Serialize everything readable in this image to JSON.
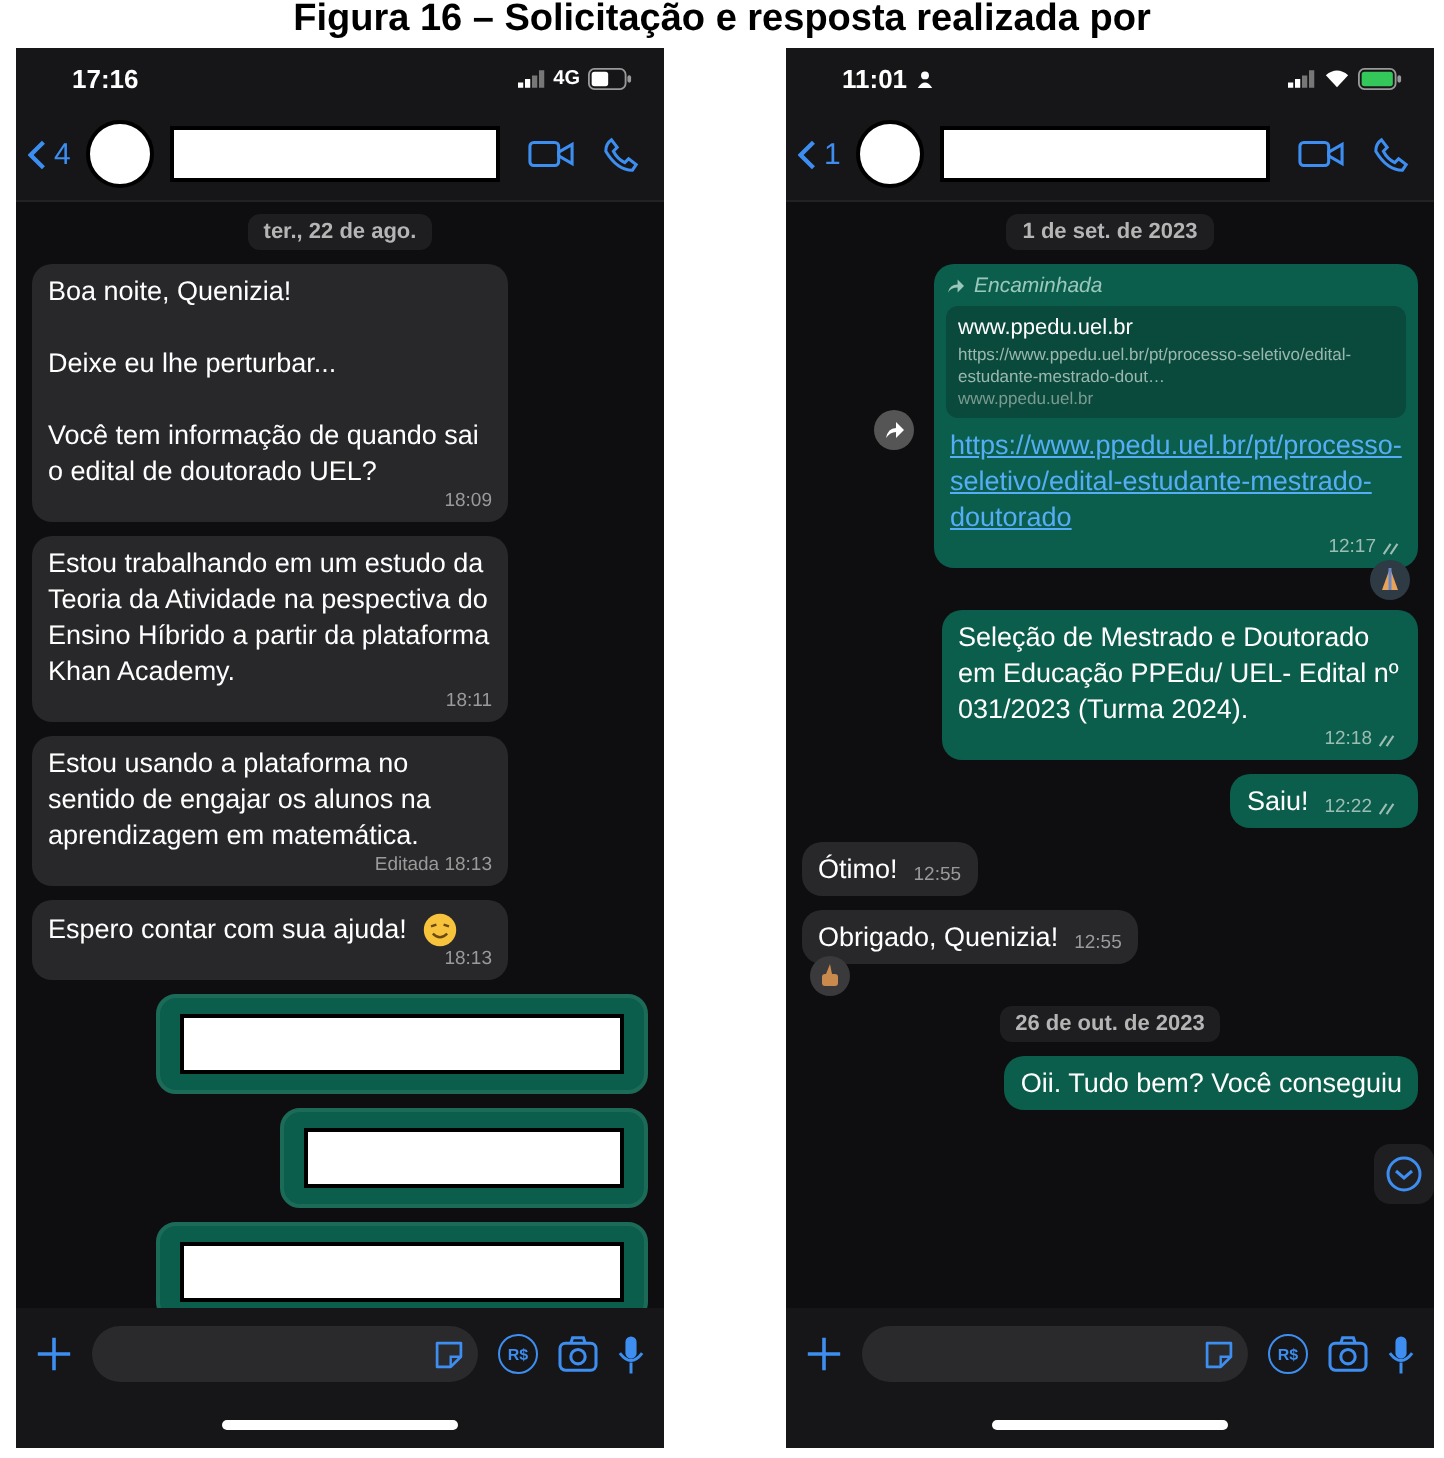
{
  "caption": "Figura 16 – Solicitação e resposta realizada por",
  "phones": [
    {
      "status": {
        "time": "17:16",
        "user_indicator": false,
        "network": "4G",
        "wifi": false,
        "charging": false
      },
      "header": {
        "back_count": "4"
      },
      "scroll_button": false,
      "messages": [
        {
          "kind": "date",
          "text": "ter., 22 de ago."
        },
        {
          "kind": "incoming",
          "paragraphs": [
            "Boa noite, Quenizia!",
            "Deixe eu lhe perturbar...",
            "Você tem informação de quando sai o edital de doutorado UEL?"
          ],
          "time": "18:09"
        },
        {
          "kind": "incoming",
          "paragraphs": [
            "Estou trabalhando em um estudo da Teoria da Atividade na pespectiva do Ensino Híbrido a partir da plataforma Khan Academy."
          ],
          "time": "18:11"
        },
        {
          "kind": "incoming",
          "paragraphs": [
            "Estou usando a plataforma no sentido de engajar os alunos na aprendizagem em matemática."
          ],
          "time": "Editada 18:13"
        },
        {
          "kind": "incoming",
          "paragraphs": [
            "Espero contar com sua ajuda!"
          ],
          "emoji": true,
          "time": "18:13"
        },
        {
          "kind": "redacted"
        },
        {
          "kind": "redacted"
        },
        {
          "kind": "redacted"
        }
      ],
      "input": {
        "payment_label": "R$"
      }
    },
    {
      "status": {
        "time": "11:01",
        "user_indicator": true,
        "wifi": true,
        "charging": true
      },
      "header": {
        "back_count": "1"
      },
      "scroll_button": true,
      "messages": [
        {
          "kind": "date",
          "text": "1 de set. de 2023"
        },
        {
          "kind": "forwarded",
          "label": "Encaminhada",
          "preview": {
            "title": "www.ppedu.uel.br",
            "description": "https://www.ppedu.uel.br/pt/processo-seletivo/edital-estudante-mestrado-dout…",
            "domain": "www.ppedu.uel.br"
          },
          "link": "https://www.ppedu.uel.br/pt/processo-seletivo/edital-estudante-mestrado-doutorado",
          "time": "12:17",
          "read": true,
          "reaction": true
        },
        {
          "kind": "outgoing",
          "paragraphs": [
            "Seleção de Mestrado e Doutorado em Educação PPEdu/ UEL- Edital nº 031/2023 (Turma 2024)."
          ],
          "time": "12:18",
          "read": true
        },
        {
          "kind": "outgoing",
          "paragraphs": [
            "Saiu!"
          ],
          "time": "12:22",
          "read": true
        },
        {
          "kind": "incoming",
          "paragraphs": [
            "Ótimo!"
          ],
          "time": "12:55"
        },
        {
          "kind": "incoming",
          "paragraphs": [
            "Obrigado, Quenizia!"
          ],
          "time": "12:55",
          "reaction": true
        },
        {
          "kind": "date",
          "text": "26 de out. de 2023"
        },
        {
          "kind": "outgoing",
          "paragraphs": [
            "Oii. Tudo bem? Você conseguiu"
          ]
        }
      ],
      "input": {
        "payment_label": "R$"
      }
    }
  ]
}
